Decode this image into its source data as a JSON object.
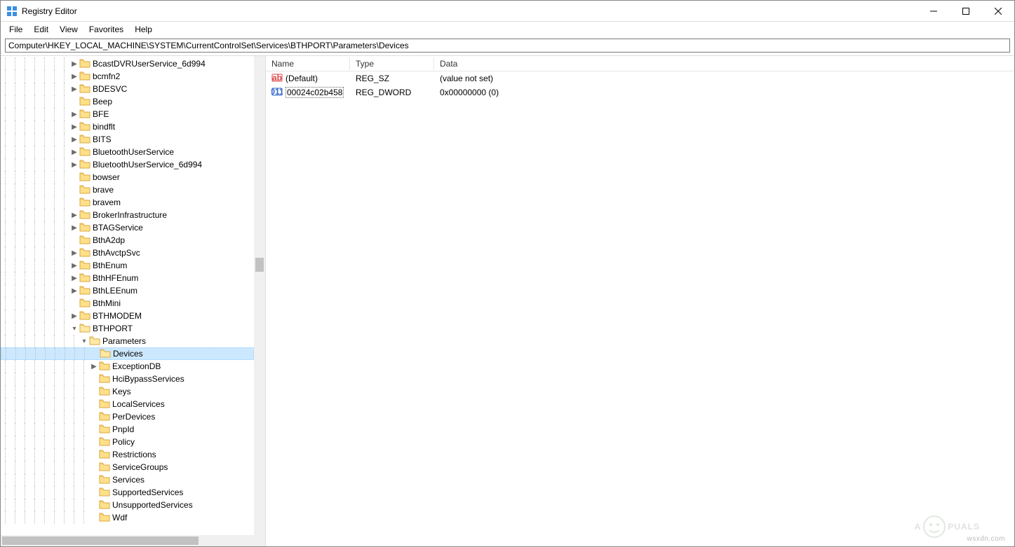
{
  "app": {
    "title": "Registry Editor"
  },
  "menu": {
    "file": "File",
    "edit": "Edit",
    "view": "View",
    "favorites": "Favorites",
    "help": "Help"
  },
  "address": "Computer\\HKEY_LOCAL_MACHINE\\SYSTEM\\CurrentControlSet\\Services\\BTHPORT\\Parameters\\Devices",
  "tree": {
    "items": [
      {
        "label": "BcastDVRUserService_6d994",
        "depth": 7,
        "exp": ">"
      },
      {
        "label": "bcmfn2",
        "depth": 7,
        "exp": ">"
      },
      {
        "label": "BDESVC",
        "depth": 7,
        "exp": ">"
      },
      {
        "label": "Beep",
        "depth": 7,
        "exp": ""
      },
      {
        "label": "BFE",
        "depth": 7,
        "exp": ">"
      },
      {
        "label": "bindflt",
        "depth": 7,
        "exp": ">"
      },
      {
        "label": "BITS",
        "depth": 7,
        "exp": ">"
      },
      {
        "label": "BluetoothUserService",
        "depth": 7,
        "exp": ">"
      },
      {
        "label": "BluetoothUserService_6d994",
        "depth": 7,
        "exp": ">"
      },
      {
        "label": "bowser",
        "depth": 7,
        "exp": ""
      },
      {
        "label": "brave",
        "depth": 7,
        "exp": ""
      },
      {
        "label": "bravem",
        "depth": 7,
        "exp": ""
      },
      {
        "label": "BrokerInfrastructure",
        "depth": 7,
        "exp": ">"
      },
      {
        "label": "BTAGService",
        "depth": 7,
        "exp": ">"
      },
      {
        "label": "BthA2dp",
        "depth": 7,
        "exp": ""
      },
      {
        "label": "BthAvctpSvc",
        "depth": 7,
        "exp": ">"
      },
      {
        "label": "BthEnum",
        "depth": 7,
        "exp": ">"
      },
      {
        "label": "BthHFEnum",
        "depth": 7,
        "exp": ">"
      },
      {
        "label": "BthLEEnum",
        "depth": 7,
        "exp": ">"
      },
      {
        "label": "BthMini",
        "depth": 7,
        "exp": ""
      },
      {
        "label": "BTHMODEM",
        "depth": 7,
        "exp": ">"
      },
      {
        "label": "BTHPORT",
        "depth": 7,
        "exp": "v"
      },
      {
        "label": "Parameters",
        "depth": 8,
        "exp": "v"
      },
      {
        "label": "Devices",
        "depth": 9,
        "exp": "",
        "selected": true
      },
      {
        "label": "ExceptionDB",
        "depth": 9,
        "exp": ">"
      },
      {
        "label": "HciBypassServices",
        "depth": 9,
        "exp": ""
      },
      {
        "label": "Keys",
        "depth": 9,
        "exp": ""
      },
      {
        "label": "LocalServices",
        "depth": 9,
        "exp": ""
      },
      {
        "label": "PerDevices",
        "depth": 9,
        "exp": ""
      },
      {
        "label": "PnpId",
        "depth": 9,
        "exp": ""
      },
      {
        "label": "Policy",
        "depth": 9,
        "exp": ""
      },
      {
        "label": "Restrictions",
        "depth": 9,
        "exp": ""
      },
      {
        "label": "ServiceGroups",
        "depth": 9,
        "exp": ""
      },
      {
        "label": "Services",
        "depth": 9,
        "exp": ""
      },
      {
        "label": "SupportedServices",
        "depth": 9,
        "exp": ""
      },
      {
        "label": "UnsupportedServices",
        "depth": 9,
        "exp": ""
      },
      {
        "label": "Wdf",
        "depth": 9,
        "exp": ""
      }
    ]
  },
  "list": {
    "headers": {
      "name": "Name",
      "type": "Type",
      "data": "Data"
    },
    "rows": [
      {
        "icon": "sz",
        "name": "(Default)",
        "type": "REG_SZ",
        "data": "(value not set)",
        "selected": false
      },
      {
        "icon": "dw",
        "name": "00024c02b458",
        "type": "REG_DWORD",
        "data": "0x00000000 (0)",
        "selected": true
      }
    ]
  },
  "watermark": "wsxdn.com",
  "brand": "A  PUALS"
}
